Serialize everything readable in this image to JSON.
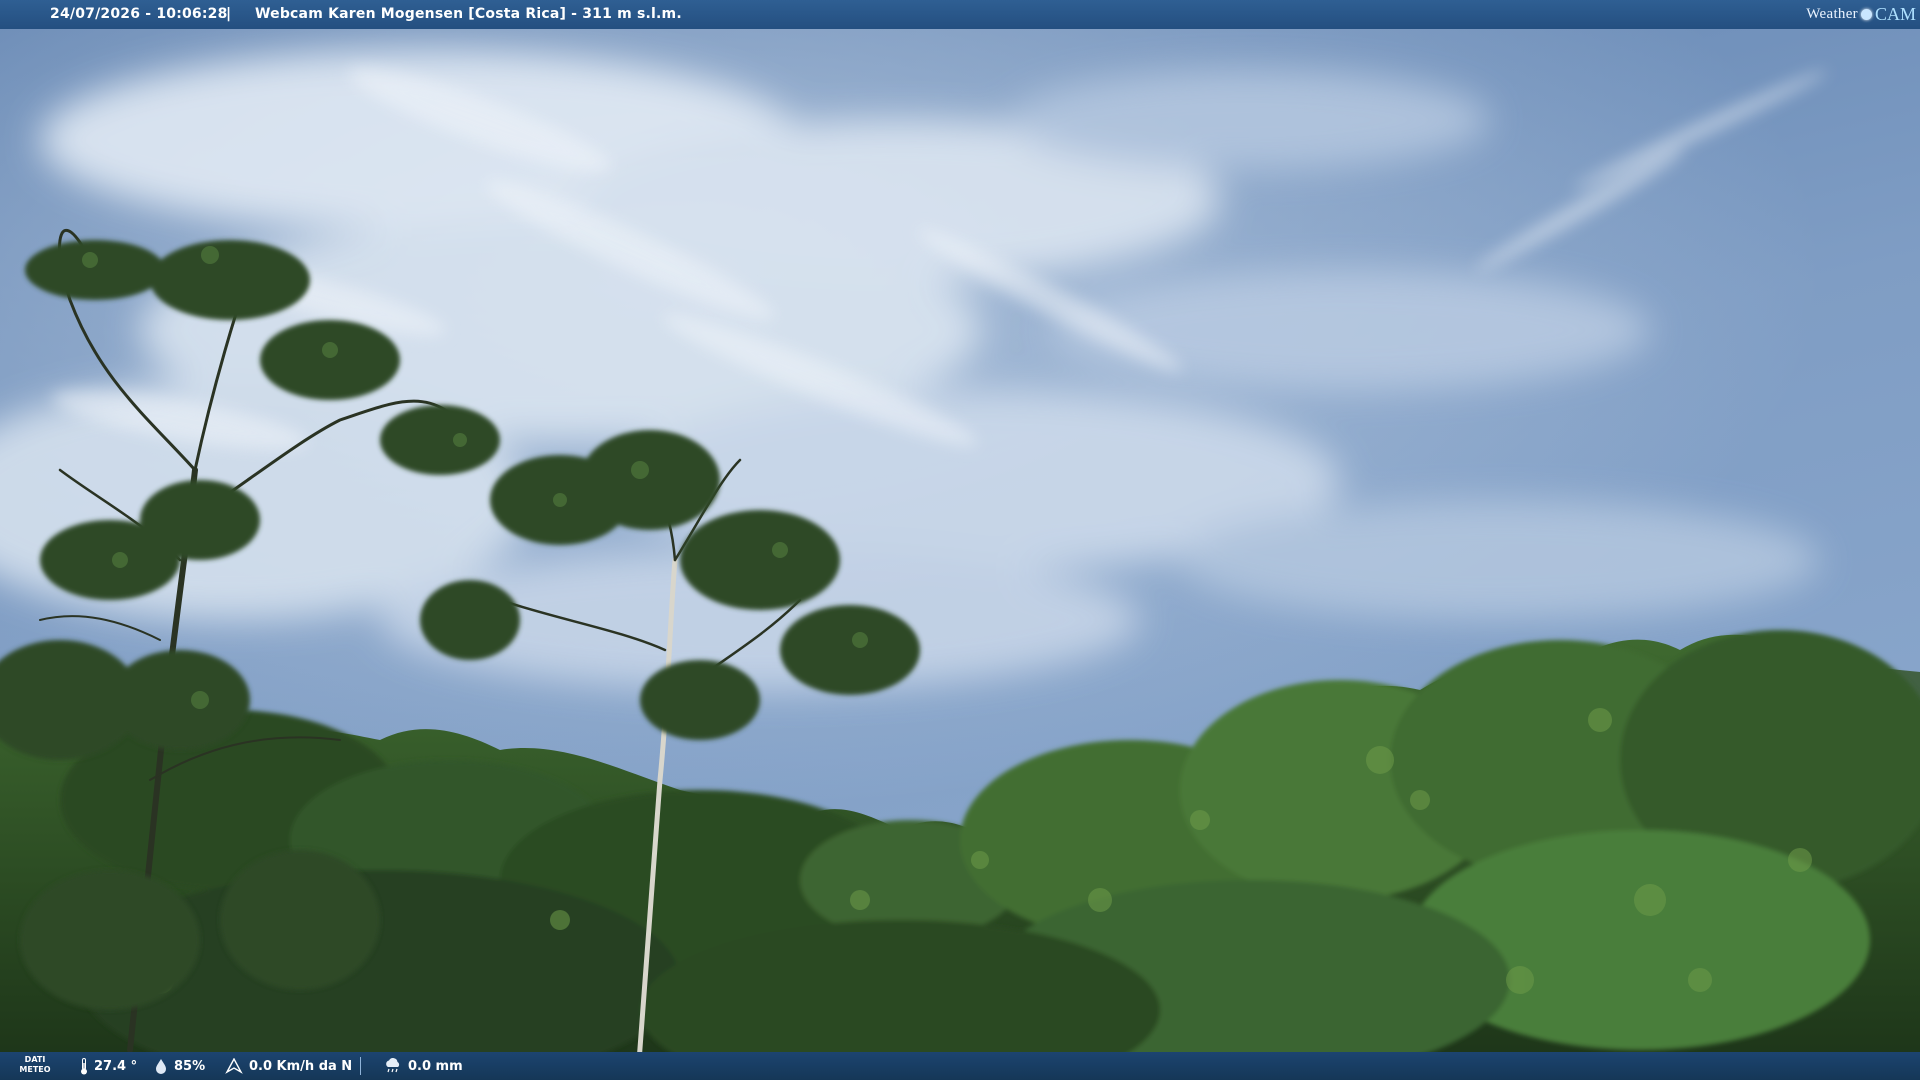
{
  "header": {
    "timestamp": "24/07/2026 - 10:06:28",
    "separator": "|",
    "title": "Webcam Karen Mogensen [Costa Rica]  - 311 m s.l.m.",
    "logo": {
      "word": "Weather",
      "cam": "CAM",
      "icon": "globe-icon"
    }
  },
  "weather": {
    "label_line1": "DATI",
    "label_line2": "METEO",
    "temperature": "27.4 °",
    "humidity": "85%",
    "wind": "0.0 Km/h da N",
    "rain": "0.0 mm",
    "icons": [
      "thermometer-icon",
      "humidity-drop-icon",
      "wind-direction-icon",
      "rain-cloud-icon"
    ]
  },
  "colors": {
    "sky_top": "#496f9f",
    "sky_bottom": "#7d9ac0",
    "cloud": "#e4ecf5",
    "forest_dark": "#1f3a1c",
    "forest_mid": "#3d6a2d",
    "forest_light": "#5f8f3f",
    "bar": "#24507f"
  }
}
